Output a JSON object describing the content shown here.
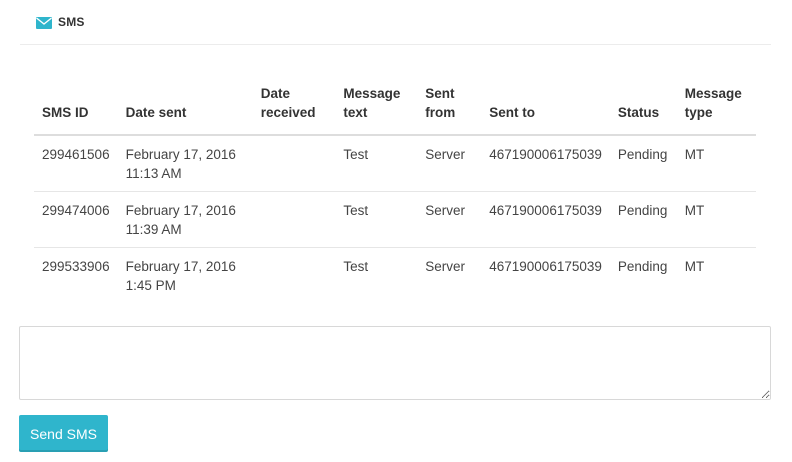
{
  "header": {
    "title": "SMS",
    "icon": "envelope-icon"
  },
  "table": {
    "columns": [
      "SMS ID",
      "Date sent",
      "Date\nreceived",
      "Message\ntext",
      "Sent\nfrom",
      "Sent to",
      "Status",
      "Message\ntype"
    ],
    "rows": [
      [
        "299461506",
        "February 17, 2016\n11:13 AM",
        "",
        "Test",
        "Server",
        "467190006175039",
        "Pending",
        "MT"
      ],
      [
        "299474006",
        "February 17, 2016\n11:39 AM",
        "",
        "Test",
        "Server",
        "467190006175039",
        "Pending",
        "MT"
      ],
      [
        "299533906",
        "February 17, 2016\n1:45 PM",
        "",
        "Test",
        "Server",
        "467190006175039",
        "Pending",
        "MT"
      ]
    ]
  },
  "compose": {
    "value": "",
    "placeholder": ""
  },
  "send_button": {
    "label": "Send SMS"
  },
  "colors": {
    "accent": "#2fb5cc",
    "icon": "#2fb5cc"
  }
}
